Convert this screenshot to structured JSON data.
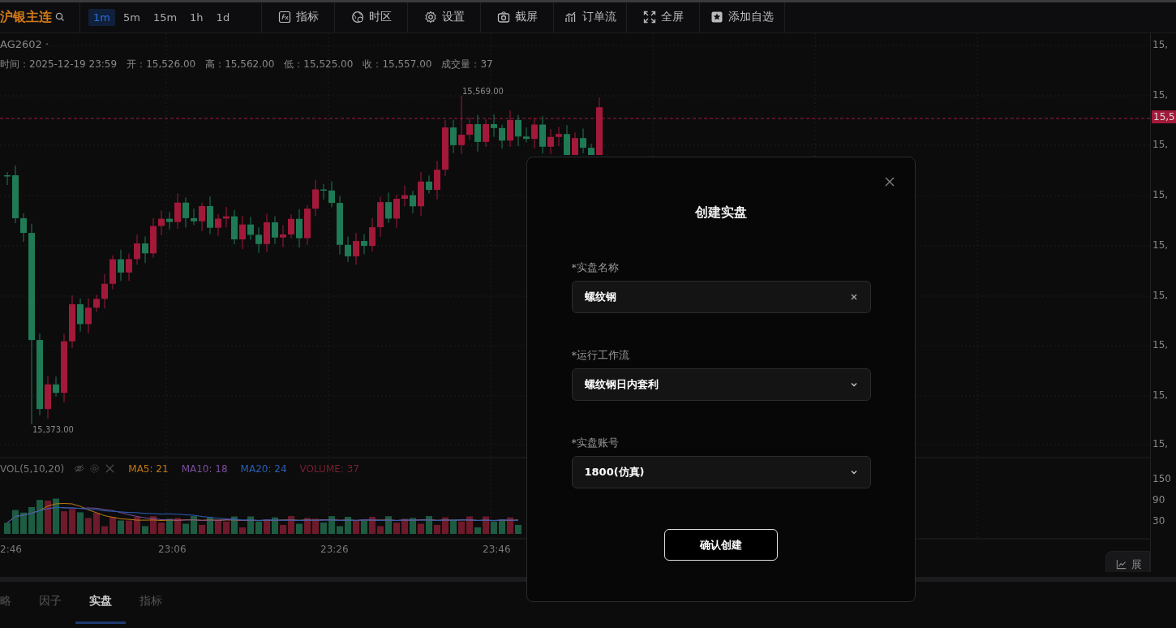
{
  "toolbar": {
    "symbol": "沪银主连",
    "intervals": [
      {
        "label": "1m",
        "selected": true
      },
      {
        "label": "5m",
        "selected": false
      },
      {
        "label": "15m",
        "selected": false
      },
      {
        "label": "1h",
        "selected": false
      },
      {
        "label": "1d",
        "selected": false
      }
    ],
    "tools": [
      {
        "kind": "fx",
        "label": "指标"
      },
      {
        "kind": "timezone",
        "label": "时区"
      },
      {
        "kind": "settings",
        "label": "设置"
      },
      {
        "kind": "camera",
        "label": "截屏"
      },
      {
        "kind": "orderflow",
        "label": "订单流"
      },
      {
        "kind": "fullscreen",
        "label": "全屏"
      },
      {
        "kind": "star",
        "label": "添加自选"
      }
    ]
  },
  "chart": {
    "contract": "AG2602 ·",
    "ohlc": [
      {
        "label": "时间：",
        "value": "2025-12-19 23:59"
      },
      {
        "label": "开：",
        "value": "15,526.00"
      },
      {
        "label": "高：",
        "value": "15,562.00"
      },
      {
        "label": "低：",
        "value": "15,525.00"
      },
      {
        "label": "收：",
        "value": "15,557.00"
      },
      {
        "label": "成交量：",
        "value": "37"
      }
    ],
    "high_mark": "15,569.00",
    "low_mark": "15,373.00",
    "price_axis": [
      "15,",
      "15,",
      "15,",
      "15,",
      "15,",
      "15,",
      "15,",
      "15,",
      "15,"
    ],
    "last_price": "15,5",
    "volume_legend": {
      "title": "VOL(5,10,20)",
      "series": [
        {
          "label": "MA5: 21",
          "color": "#c07a10"
        },
        {
          "label": "MA10: 18",
          "color": "#7b4f9a"
        },
        {
          "label": "MA20: 24",
          "color": "#2b5fb5"
        },
        {
          "label": "VOLUME: 37",
          "color": "#7a1f30"
        }
      ]
    },
    "volume_axis": [
      "150",
      "90",
      "30"
    ],
    "time_axis": [
      "2:46",
      "23:06",
      "23:26",
      "23:46"
    ],
    "expand_button": "展"
  },
  "bottom_tabs": [
    {
      "label": "略",
      "selected": false
    },
    {
      "label": "因子",
      "selected": false
    },
    {
      "label": "实盘",
      "selected": true
    },
    {
      "label": "指标",
      "selected": false
    }
  ],
  "dialog": {
    "title": "创建实盘",
    "fields": [
      {
        "kind": "input",
        "label": "*实盘名称",
        "value": "螺纹钢"
      },
      {
        "kind": "select",
        "label": "*运行工作流",
        "value": "螺纹钢日内套利"
      },
      {
        "kind": "select",
        "label": "*实盘账号",
        "value": "1800(仿真)"
      }
    ],
    "confirm": "确认创建"
  }
}
